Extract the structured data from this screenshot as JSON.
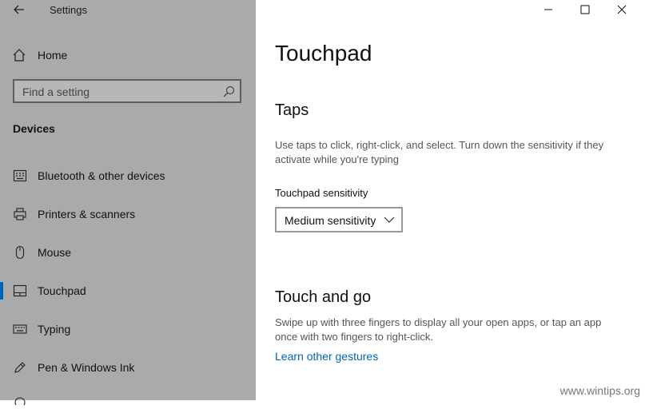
{
  "app": {
    "title": "Settings"
  },
  "nav": {
    "home_label": "Home",
    "search_placeholder": "Find a setting",
    "section_title": "Devices",
    "items": [
      {
        "label": "Bluetooth & other devices",
        "icon": "keyboard-icon"
      },
      {
        "label": "Printers & scanners",
        "icon": "printer-icon"
      },
      {
        "label": "Mouse",
        "icon": "mouse-icon"
      },
      {
        "label": "Touchpad",
        "icon": "touchpad-icon",
        "selected": true
      },
      {
        "label": "Typing",
        "icon": "keyboard-icon"
      },
      {
        "label": "Pen & Windows Ink",
        "icon": "pen-icon"
      }
    ]
  },
  "main": {
    "title": "Touchpad",
    "taps": {
      "heading": "Taps",
      "description": "Use taps to click, right-click, and select. Turn down the sensitivity if they activate while you're typing",
      "sensitivity_label": "Touchpad sensitivity",
      "sensitivity_value": "Medium sensitivity"
    },
    "touch_and_go": {
      "heading": "Touch and go",
      "description": "Swipe up with three fingers to display all your open apps, or tap an app once with two fingers to right-click.",
      "link": "Learn other gestures"
    }
  },
  "watermark": "www.wintips.org",
  "colors": {
    "sidebar_bg": "#aaaaaa",
    "accent": "#0063b1",
    "link": "#0066b4"
  }
}
